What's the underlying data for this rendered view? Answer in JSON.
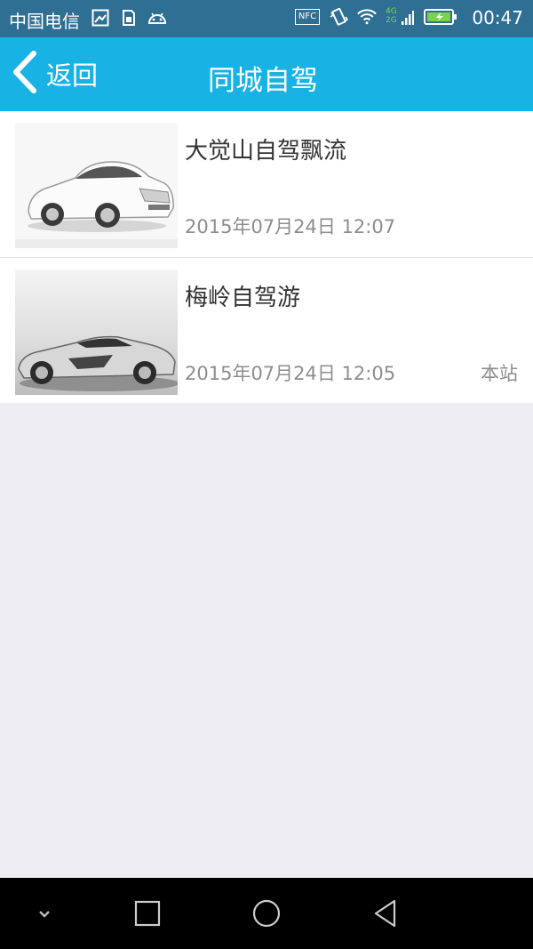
{
  "status_bar": {
    "carrier": "中国电信",
    "time": "00:47",
    "nfc": "NFC",
    "net_top": "4G",
    "net_bottom": "2G",
    "icons": [
      "image-icon",
      "sim-icon",
      "android-icon",
      "nfc-icon",
      "vibrate-icon",
      "wifi-icon",
      "signal-icon",
      "battery-icon"
    ]
  },
  "header": {
    "back_label": "返回",
    "title": "同城自驾"
  },
  "list": [
    {
      "title": "大觉山自驾飘流",
      "date": "2015年07月24日 12:07",
      "source": "",
      "thumb": "white-sedan-photo"
    },
    {
      "title": "梅岭自驾游",
      "date": "2015年07月24日 12:05",
      "source": "本站",
      "thumb": "silver-sports-car-photo"
    }
  ],
  "nav_bar": {
    "buttons": [
      "chevron-down-icon",
      "recent-apps-icon",
      "home-icon",
      "back-icon"
    ]
  },
  "colors": {
    "header_bg": "#18b2e4",
    "status_bg": "#2f6f94",
    "page_bg": "#eeeef2"
  }
}
